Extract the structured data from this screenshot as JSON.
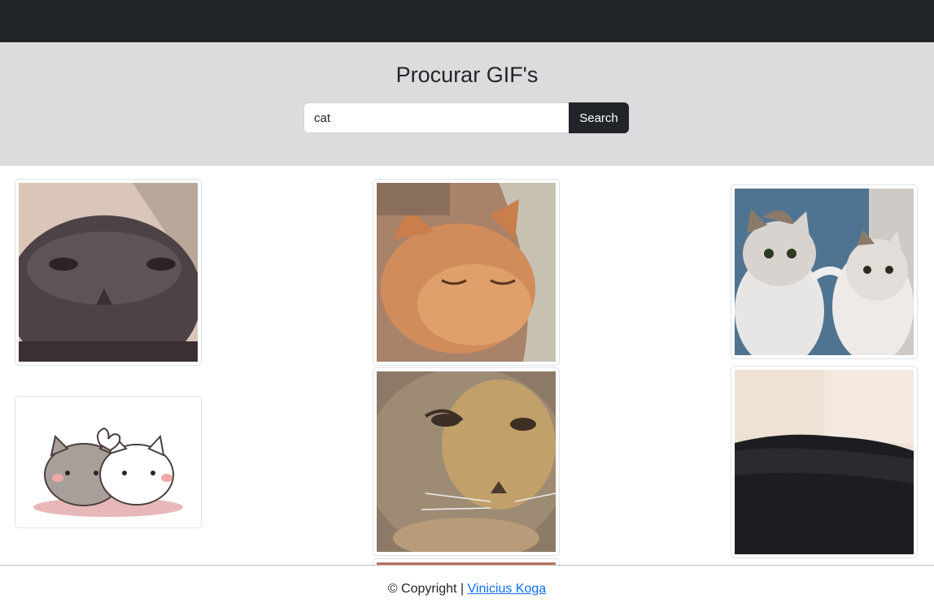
{
  "header": {
    "title": "Procurar GIF's"
  },
  "search": {
    "value": "cat",
    "button_label": "Search"
  },
  "gifs": [
    {
      "name": "gray-cat-closeup"
    },
    {
      "name": "orange-cat-sleeping"
    },
    {
      "name": "two-cats-pawing"
    },
    {
      "name": "cartoon-cats-heart"
    },
    {
      "name": "tabby-cat-sad"
    },
    {
      "name": "dark-cat-shadow"
    },
    {
      "name": "partial-gif"
    }
  ],
  "footer": {
    "copyright_text": "© Copyright |",
    "author_link": "Vinicius Koga"
  },
  "colors": {
    "navbar": "#212529",
    "hero": "#dcdcde",
    "button": "#212529",
    "link": "#0d6efd"
  }
}
